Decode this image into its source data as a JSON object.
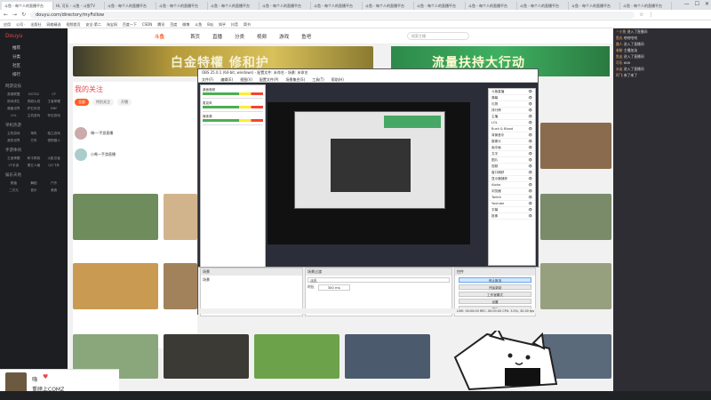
{
  "browser": {
    "tabs": [
      "斗鱼 - 每个人的直播平台",
      "Hi, 可乐 - 斗鱼 - 斗鱼TV",
      "斗鱼 - 每个人的直播平台",
      "斗鱼 - 每个人的直播平台",
      "斗鱼 - 每个人的直播平台",
      "斗鱼 - 每个人的直播平台",
      "斗鱼 - 每个人的直播平台",
      "斗鱼 - 每个人的直播平台",
      "斗鱼 - 每个人的直播平台",
      "斗鱼 - 每个人的直播平台",
      "斗鱼 - 每个人的直播平台",
      "斗鱼 - 每个人的直播平台",
      "斗鱼 - 每个人的直播平台"
    ],
    "url": "douyu.com/directory/myFollow",
    "bookmarks": [
      "应用",
      "公司 ·",
      "出版社",
      "网络精选",
      "视频首页",
      "安全·第二",
      "淘宝网",
      "百度一下",
      "CSDN",
      "腾讯",
      "百度",
      "微博",
      "斗鱼",
      "B站",
      "知乎",
      "抖音",
      "简书"
    ]
  },
  "sidebar": {
    "logo": "Douyu",
    "items": [
      "推荐",
      "分类",
      "社区",
      "排行"
    ],
    "groups": [
      {
        "title": "网游竞技",
        "tags": [
          "英雄联盟",
          "DOTA2",
          "CF",
          "绝地求生",
          "穿越火线",
          "王者荣耀",
          "魔兽世界",
          "炉石传说",
          "DNF",
          "LOL",
          "主机游戏",
          "怀旧游戏"
        ]
      },
      {
        "title": "单机热游",
        "tags": [
          "主机游戏",
          "单机",
          "独立游戏",
          "我的世界",
          "方舟",
          "怪物猎人"
        ]
      },
      {
        "title": "手游休闲",
        "tags": [
          "王者荣耀",
          "和平精英",
          "火影忍者",
          "CF手游",
          "第五人格",
          "QQ飞车"
        ]
      },
      {
        "title": "娱乐天地",
        "tags": [
          "颜值",
          "舞蹈",
          "户外",
          "二次元",
          "音乐",
          "美食"
        ]
      }
    ]
  },
  "topnav": {
    "logo": "斗鱼",
    "links": [
      "首页",
      "直播",
      "分类",
      "视频",
      "游戏",
      "鱼吧"
    ],
    "search_placeholder": "搜索主播"
  },
  "banners": {
    "left": "白金特權 修和护",
    "right": "流量扶持大行动"
  },
  "follow": {
    "title": "我的关注",
    "chips": [
      "全部",
      "特别关注",
      "开播"
    ],
    "streamer_labels": [
      "嗨一·手游直播",
      "小希一手游直播"
    ]
  },
  "obs": {
    "title": "OBS 25.0.1 (64-bit, windows) - 配置文件: 未命名 - 场景: 未命名",
    "menu": [
      "文件(F)",
      "编辑(E)",
      "视图(V)",
      "配置文件(P)",
      "场景集合(S)",
      "工具(T)",
      "帮助(H)"
    ],
    "mixer_labels": [
      "桌面音频",
      "麦克风",
      "媒体源"
    ],
    "sources": [
      "斗鱼直播",
      "弹幕",
      "礼物",
      "排行榜",
      "主播",
      "LOL",
      "Bush & Blood",
      "背景音乐",
      "摄像头",
      "画中画",
      "文字",
      "图片",
      "视频",
      "窗口捕获",
      "显示器捕获",
      "Alpha",
      "浏览器",
      "Twitch",
      "Youtube",
      "字幕",
      "抠像"
    ],
    "scenes_title": "场景",
    "scenes": [
      "场景"
    ],
    "transition_title": "场景过渡",
    "transition_value": "淡出",
    "duration_label": "时长",
    "duration_value": "300 ms",
    "controls_title": "控件",
    "controls": [
      "停止推流",
      "开始录制",
      "工作室模式",
      "设置",
      "退出"
    ],
    "status": "LIVE: 00:00:00  REC: 00:00:00  CPU: 3.5%, 30.00 fps"
  },
  "chat": [
    {
      "user": "丶小鱼",
      "text": "进入了直播间"
    },
    {
      "user": "鱼丸",
      "text": "哈哈哈哈"
    },
    {
      "user": "路人",
      "text": "进入了直播间"
    },
    {
      "user": "老粉",
      "text": "主播加油"
    },
    {
      "user": "鱼友",
      "text": "进入了直播间"
    },
    {
      "user": "可乐",
      "text": "666"
    },
    {
      "user": "水友",
      "text": "进入了直播间"
    },
    {
      "user": "阿飞",
      "text": "来了来了"
    }
  ],
  "streamer": {
    "name": "嗨",
    "subtitle": "重磅上COMZ"
  },
  "colors": {
    "brand": "#ff5d23",
    "accent_red": "#e5484d",
    "sidebar_bg": "#1d1e22",
    "chat_bg": "#2d2d33"
  }
}
